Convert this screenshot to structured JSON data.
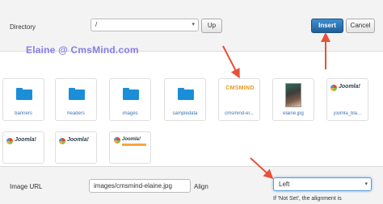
{
  "directory": {
    "label": "Directory",
    "value": "/",
    "up_label": "Up"
  },
  "actions": {
    "insert_label": "Insert",
    "cancel_label": "Cancel"
  },
  "watermark": "Elaine @ CmsMind.com",
  "tiles_row1": [
    {
      "label": "banners",
      "type": "folder"
    },
    {
      "label": "headers",
      "type": "folder"
    },
    {
      "label": "images",
      "type": "folder"
    },
    {
      "label": "sampledata",
      "type": "folder"
    },
    {
      "label": "cmsmind-el...",
      "type": "image",
      "logo_text": "CMSMIND"
    },
    {
      "label": "elaine.jpg",
      "type": "photo"
    },
    {
      "label": "joomla_bla...",
      "type": "image",
      "logo_text": "Joomla!"
    }
  ],
  "tiles_row2": [
    {
      "type": "image",
      "logo_text": "Joomla!"
    },
    {
      "type": "image",
      "logo_text": "Joomla!"
    },
    {
      "type": "image",
      "logo_text": "Joomla!"
    }
  ],
  "footer": {
    "image_url_label": "Image URL",
    "image_url_value": "images/cmsmind-elaine.jpg",
    "align_label": "Align",
    "align_value": "Left",
    "align_help": "If 'Not Set', the alignment is"
  },
  "colors": {
    "folder": "#1a8fd8",
    "arrow": "#e8503a",
    "insert_bg": "#2b74b8",
    "watermark": "#8a7ee6"
  }
}
